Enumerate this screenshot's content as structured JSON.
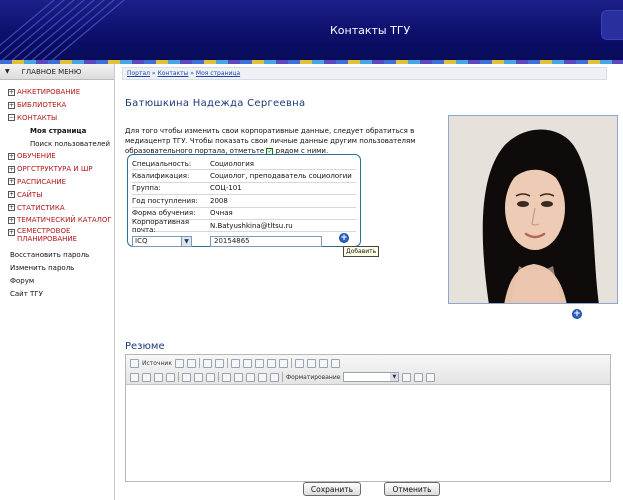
{
  "header": {
    "title": "Контакты ТГУ"
  },
  "sidebar": {
    "menu_title": "ГЛАВНОЕ МЕНЮ",
    "items": [
      {
        "box": "+",
        "label": "АНКЕТИРОВАНИЕ"
      },
      {
        "box": "+",
        "label": "БИБЛИОТЕКА"
      },
      {
        "box": "−",
        "label": "КОНТАКТЫ"
      }
    ],
    "sub_items": [
      {
        "label": "Моя страница"
      },
      {
        "label": "Поиск пользователей"
      }
    ],
    "items2": [
      {
        "box": "+",
        "label": "ОБУЧЕНИЕ"
      },
      {
        "box": "+",
        "label": "ОРГСТРУКТУРА И ШР"
      },
      {
        "box": "+",
        "label": "РАСПИСАНИЕ"
      },
      {
        "box": "+",
        "label": "САЙТЫ"
      },
      {
        "box": "+",
        "label": "СТАТИСТИКА"
      },
      {
        "box": "+",
        "label": "ТЕМАТИЧЕСКИЙ КАТАЛОГ"
      },
      {
        "box": "+",
        "label": "СЕМЕСТРОВОЕ ПЛАНИРОВАНИЕ"
      }
    ],
    "links": [
      "Восстановить пароль",
      "Изменить пароль",
      "Форум",
      "Сайт ТГУ"
    ]
  },
  "breadcrumb": {
    "portal": "Портал",
    "contacts": "Контакты",
    "page": "Моя страница",
    "sep": " » "
  },
  "profile": {
    "name": "Батюшкина  Надежда  Сергеевна",
    "intro_1": "Для того чтобы изменить свои корпоративные данные, следует обратиться в медиацентр ТГУ. Чтобы показать свои личные данные другим пользователям образовательного портала, отметьте",
    "intro_2": "рядом с ними.",
    "fields": [
      {
        "key": "Специальность:",
        "value": "Социология"
      },
      {
        "key": "Квалификация:",
        "value": "Социолог, преподаватель социологии"
      },
      {
        "key": "Группа:",
        "value": "СОЦ-101"
      },
      {
        "key": "Год поступления:",
        "value": "2008"
      },
      {
        "key": "Форма обучения:",
        "value": "Очная"
      },
      {
        "key": "Корпоративная почта:",
        "value": "N.Batyushkina@tltsu.ru"
      }
    ],
    "contact_type": "ICQ",
    "contact_value": "20154865",
    "add_tooltip": "Добавить"
  },
  "resume": {
    "title": "Резюме",
    "source_label": "Источник",
    "format_label": "Форматирование"
  },
  "buttons": {
    "save": "Сохранить",
    "cancel": "Отменить"
  },
  "colors": {
    "header": "#0c0e6a",
    "menu_red": "#b01818",
    "title_blue": "#1a3a7a",
    "frame_blue": "#2a6fa0"
  }
}
